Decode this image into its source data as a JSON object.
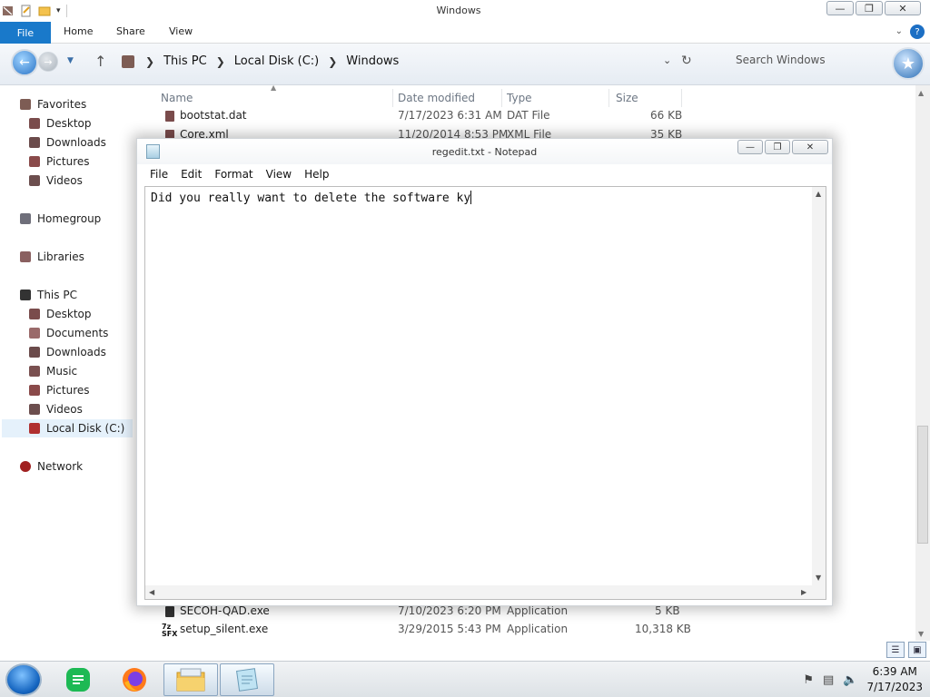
{
  "explorer": {
    "title": "Windows",
    "ribbon_tabs": [
      "File",
      "Home",
      "Share",
      "View"
    ],
    "help_label": "?",
    "breadcrumb": [
      "This PC",
      "Local Disk (C:)",
      "Windows"
    ],
    "search_placeholder": "Search Windows",
    "nav_groups": {
      "favorites": {
        "label": "Favorites",
        "items": [
          "Desktop",
          "Downloads",
          "Pictures",
          "Videos"
        ]
      },
      "homegroup": "Homegroup",
      "libraries": "Libraries",
      "this_pc": {
        "label": "This PC",
        "items": [
          "Desktop",
          "Documents",
          "Downloads",
          "Music",
          "Pictures",
          "Videos",
          "Local Disk (C:)"
        ]
      },
      "network": "Network"
    },
    "columns": [
      "Name",
      "Date modified",
      "Type",
      "Size"
    ],
    "files_top": [
      {
        "name": "bootstat.dat",
        "date": "7/17/2023 6:31 AM",
        "type": "DAT File",
        "size": "66 KB"
      },
      {
        "name": "Core.xml",
        "date": "11/20/2014 8:53 PM",
        "type": "XML File",
        "size": "35 KB"
      }
    ],
    "files_bottom": [
      {
        "name": "SECOH-QAD.exe",
        "date": "7/10/2023 6:20 PM",
        "type": "Application",
        "size": "5 KB"
      },
      {
        "name": "setup_silent.exe",
        "date": "3/29/2015 5:43 PM",
        "type": "Application",
        "size": "10,318 KB"
      }
    ],
    "window_controls": {
      "minimize": "—",
      "restore": "❐",
      "close": "✕"
    }
  },
  "notepad": {
    "title": "regedit.txt - Notepad",
    "menu": [
      "File",
      "Edit",
      "Format",
      "View",
      "Help"
    ],
    "content": "Did you really want to delete the software ky"
  },
  "taskbar": {
    "apps": [
      "start-orb",
      "sublime-notes",
      "firefox",
      "file-explorer",
      "notepad"
    ],
    "time": "6:39 AM",
    "date": "7/17/2023"
  }
}
